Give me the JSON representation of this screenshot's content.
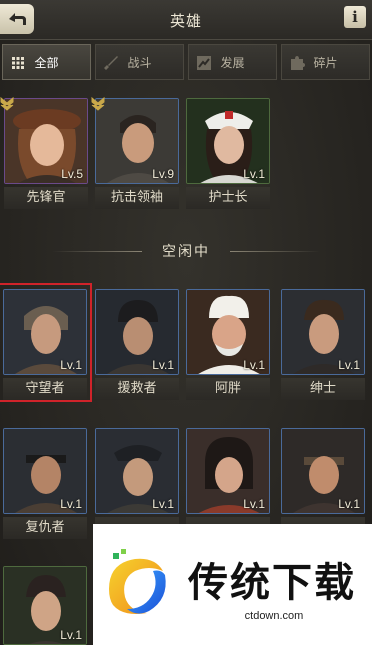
{
  "header": {
    "title": "英雄",
    "back_icon": "back-arrow-icon",
    "info_label": "i"
  },
  "tabs": [
    {
      "label": "全部",
      "icon": "grid-icon",
      "active": true
    },
    {
      "label": "战斗",
      "icon": "sword-icon",
      "active": false
    },
    {
      "label": "发展",
      "icon": "growth-icon",
      "active": false
    },
    {
      "label": "碎片",
      "icon": "puzzle-icon",
      "active": false
    }
  ],
  "assigned_heroes": [
    {
      "name": "先锋官",
      "level": "Lv.5",
      "rarity": "purple"
    },
    {
      "name": "抗击领袖",
      "level": "Lv.9",
      "rarity": "blue"
    },
    {
      "name": "护士长",
      "level": "Lv.1",
      "rarity": "green"
    }
  ],
  "idle_section": {
    "label": "空闲中"
  },
  "idle_heroes": [
    {
      "name": "守望者",
      "level": "Lv.1",
      "selected": true
    },
    {
      "name": "援救者",
      "level": "Lv.1"
    },
    {
      "name": "阿胖",
      "level": "Lv.1"
    },
    {
      "name": "绅士",
      "level": "Lv.1"
    },
    {
      "name": "复仇者",
      "level": "Lv.1"
    },
    {
      "name": "",
      "level": "Lv.1"
    },
    {
      "name": "",
      "level": "Lv.1"
    },
    {
      "name": "",
      "level": "Lv.1"
    },
    {
      "name": "",
      "level": "Lv.1"
    }
  ],
  "watermark": {
    "title": "传统下载",
    "url": "ctdown.com"
  },
  "colors": {
    "selected_frame": "#d0232a",
    "accent": "#e8e2d0"
  }
}
